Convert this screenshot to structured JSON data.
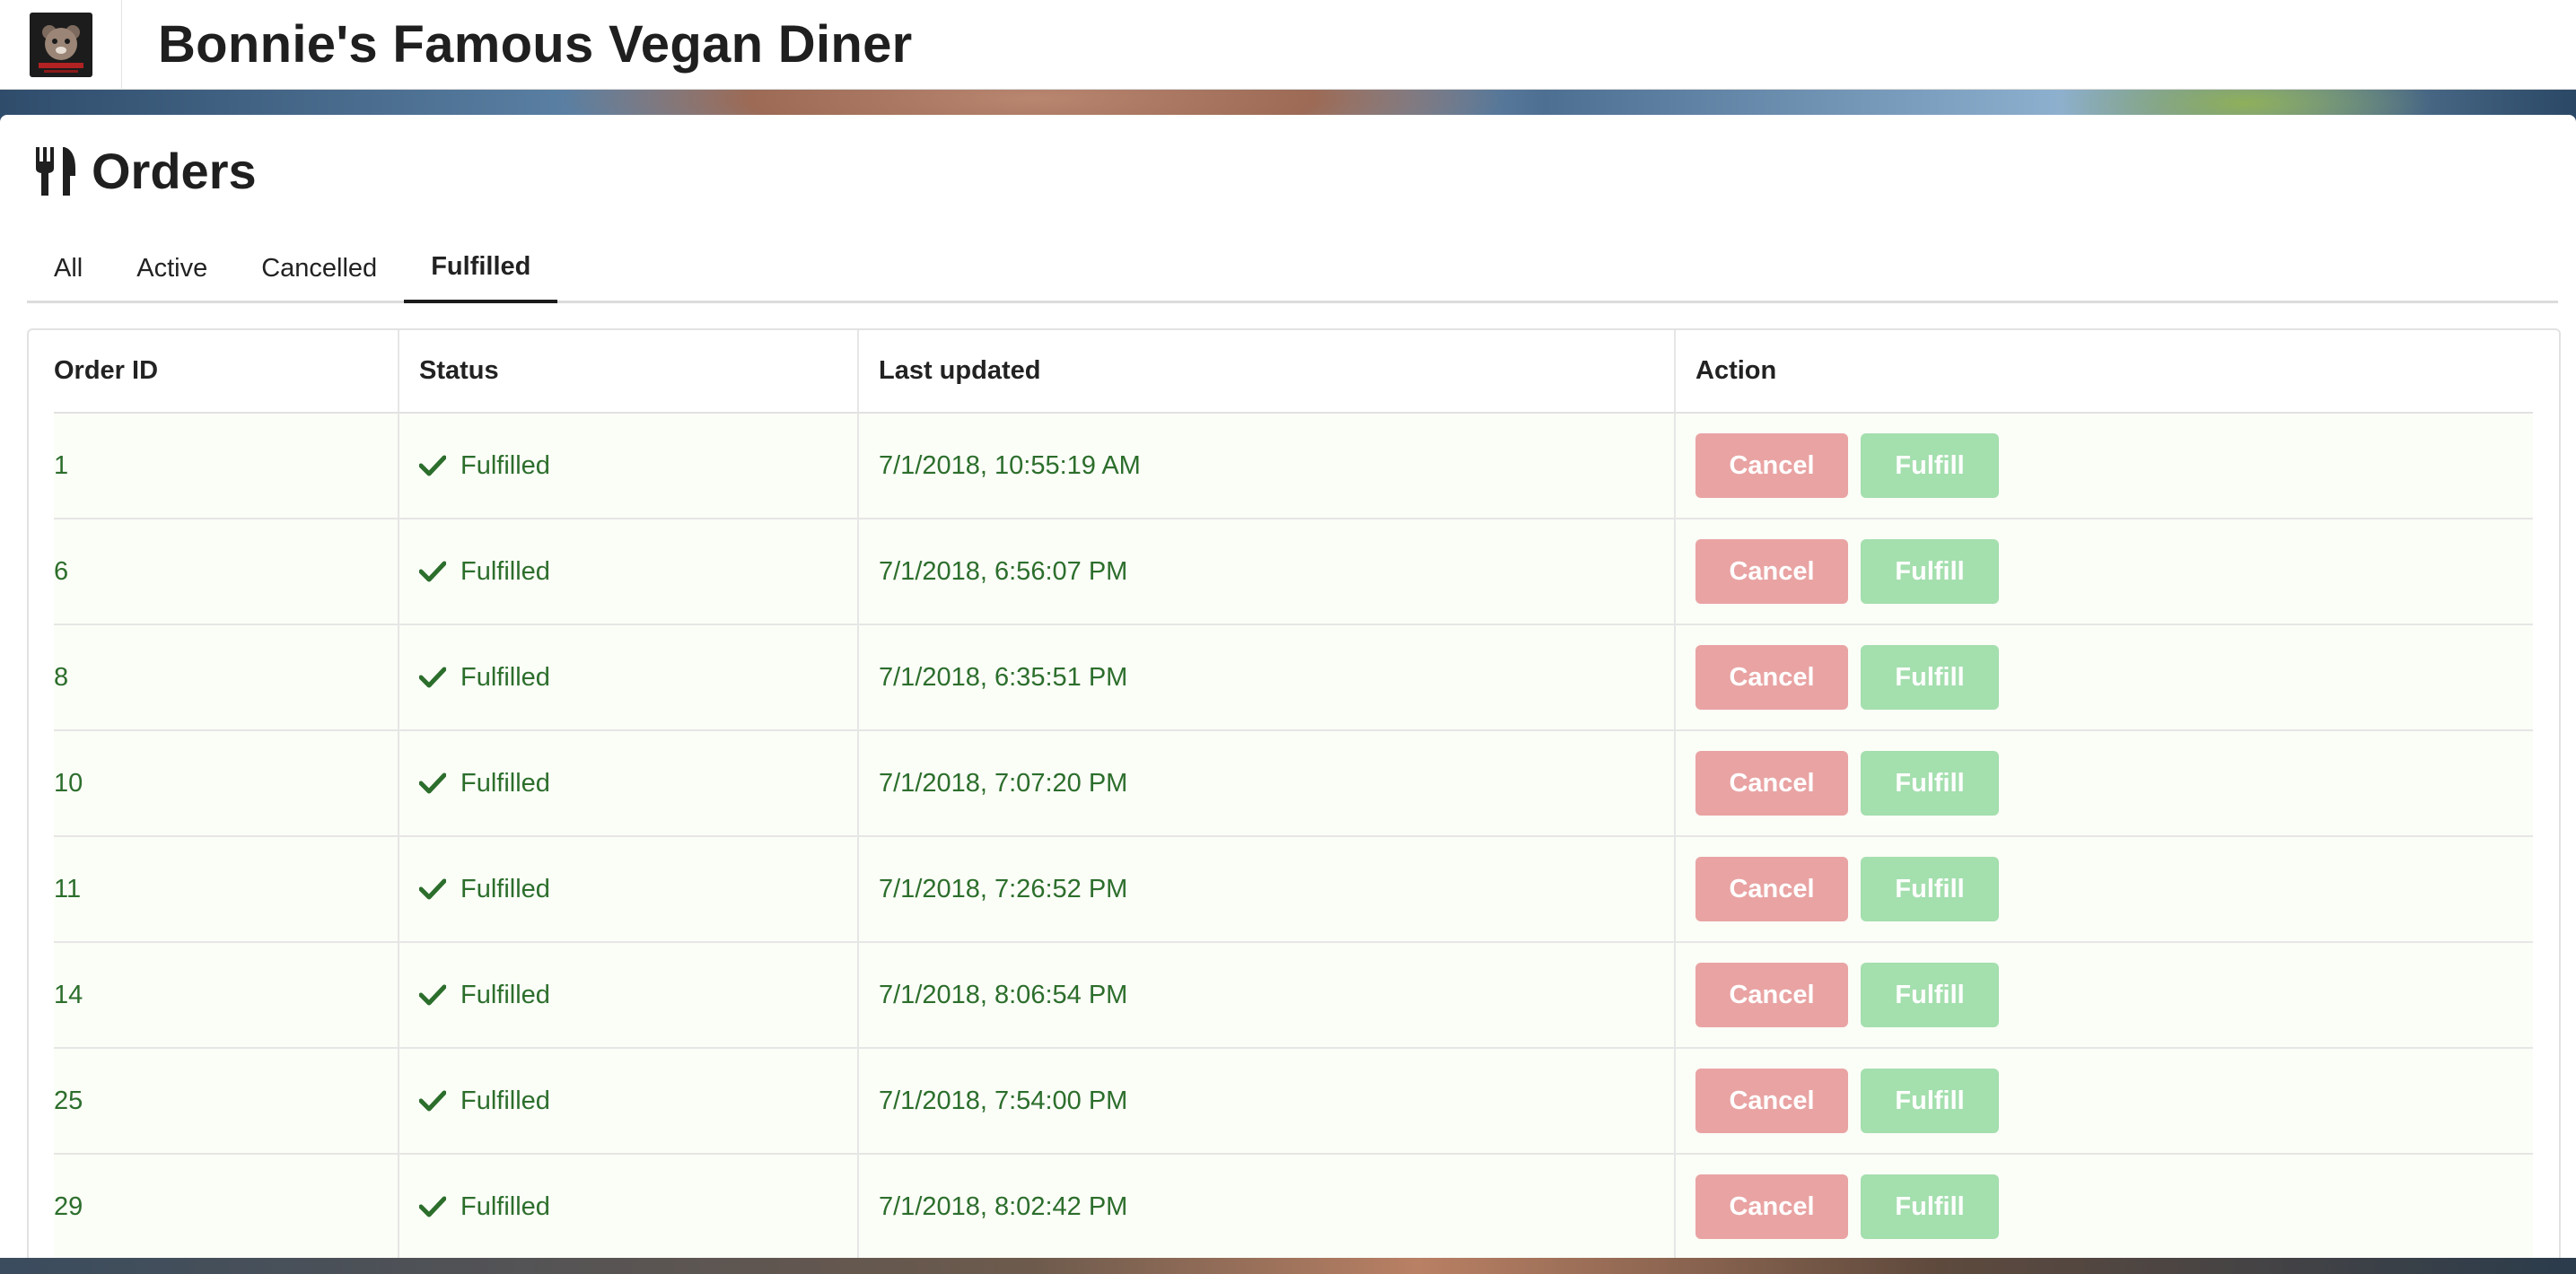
{
  "header": {
    "title": "Bonnie's Famous Vegan Diner"
  },
  "page": {
    "title": "Orders"
  },
  "tabs": [
    {
      "label": "All",
      "active": false
    },
    {
      "label": "Active",
      "active": false
    },
    {
      "label": "Cancelled",
      "active": false
    },
    {
      "label": "Fulfilled",
      "active": true
    }
  ],
  "table": {
    "columns": [
      "Order ID",
      "Status",
      "Last updated",
      "Action"
    ],
    "rows": [
      {
        "id": "1",
        "status": "Fulfilled",
        "updated": "7/1/2018, 10:55:19 AM"
      },
      {
        "id": "6",
        "status": "Fulfilled",
        "updated": "7/1/2018, 6:56:07 PM"
      },
      {
        "id": "8",
        "status": "Fulfilled",
        "updated": "7/1/2018, 6:35:51 PM"
      },
      {
        "id": "10",
        "status": "Fulfilled",
        "updated": "7/1/2018, 7:07:20 PM"
      },
      {
        "id": "11",
        "status": "Fulfilled",
        "updated": "7/1/2018, 7:26:52 PM"
      },
      {
        "id": "14",
        "status": "Fulfilled",
        "updated": "7/1/2018, 8:06:54 PM"
      },
      {
        "id": "25",
        "status": "Fulfilled",
        "updated": "7/1/2018, 7:54:00 PM"
      },
      {
        "id": "29",
        "status": "Fulfilled",
        "updated": "7/1/2018, 8:02:42 PM"
      }
    ],
    "action_labels": {
      "cancel": "Cancel",
      "fulfill": "Fulfill"
    }
  },
  "colors": {
    "row_text": "#2c6e2c",
    "row_bg": "#fbfdf7",
    "cancel_button": "#e9a3a3",
    "fulfill_button": "#a4dfae"
  },
  "icons": {
    "page_header": "fork-knife-icon",
    "status": "checkmark-icon"
  }
}
